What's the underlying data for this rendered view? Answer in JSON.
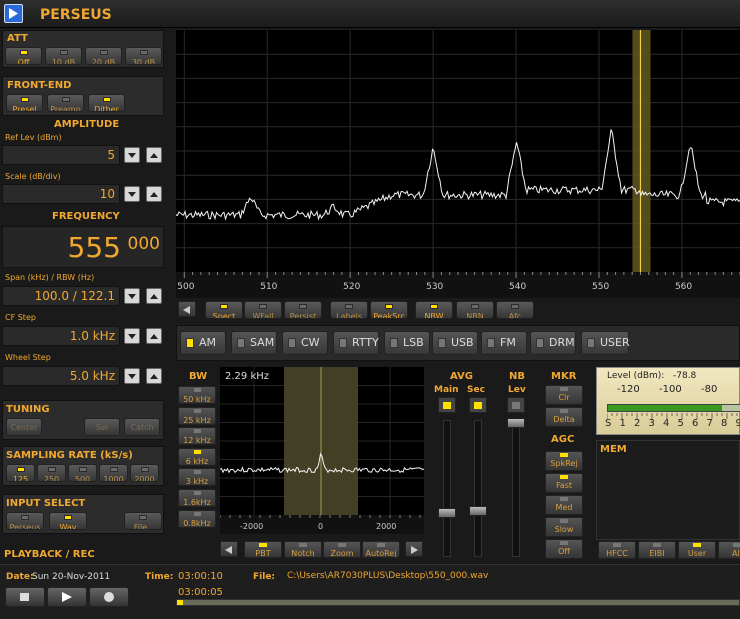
{
  "app": {
    "title": "PERSEUS"
  },
  "att": {
    "title": "ATT",
    "buttons": [
      {
        "label": "Off",
        "on": true
      },
      {
        "label": "10 dB",
        "on": false
      },
      {
        "label": "20 dB",
        "on": false
      },
      {
        "label": "30 dB",
        "on": false
      }
    ]
  },
  "frontend": {
    "title": "FRONT-END",
    "buttons": [
      {
        "label": "Presel",
        "on": true
      },
      {
        "label": "Preamp",
        "on": false
      },
      {
        "label": "Dither",
        "on": true
      }
    ]
  },
  "amplitude": {
    "title": "AMPLITUDE",
    "ref_label": "Ref Lev (dBm)",
    "ref_value": "5",
    "scale_label": "Scale (dB/div)",
    "scale_value": "10"
  },
  "frequency": {
    "title": "FREQUENCY",
    "main": "555",
    "sub": "000",
    "span_label": "Span (kHz) / RBW (Hz)",
    "span_value": "100.0 / 122.1",
    "cf_label": "CF Step",
    "cf_value": "1.0 kHz",
    "wheel_label": "Wheel Step",
    "wheel_value": "5.0 kHz"
  },
  "tuning": {
    "title": "TUNING",
    "buttons": [
      "Center",
      "Sel",
      "Catch"
    ]
  },
  "sampling": {
    "title": "SAMPLING RATE (kS/s)",
    "buttons": [
      {
        "label": "125",
        "on": true
      },
      {
        "label": "250",
        "on": false
      },
      {
        "label": "500",
        "on": false
      },
      {
        "label": "1000",
        "on": false
      },
      {
        "label": "2000",
        "on": false
      }
    ]
  },
  "input": {
    "title": "INPUT SELECT",
    "buttons": [
      {
        "label": "Perseus",
        "on": false
      },
      {
        "label": "Wav",
        "on": true
      },
      {
        "label": "File..",
        "on": false
      }
    ]
  },
  "playback": {
    "title": "PLAYBACK / REC",
    "date_label": "Date:",
    "date": "Sun 20-Nov-2011",
    "time_label": "Time:",
    "time": "03:00:10",
    "file_label": "File:",
    "file": "C:\\Users\\AR7030PLUS\\Desktop\\550_000.wav",
    "elapsed": "03:00:05",
    "progress": 0.01
  },
  "spectrum": {
    "x_ticks": [
      "500",
      "510",
      "520",
      "530",
      "540",
      "550",
      "560"
    ],
    "x_range": [
      499,
      567
    ],
    "marker": 555,
    "buttons": [
      {
        "label": "Spect",
        "on": true
      },
      {
        "label": "WFall",
        "on": false
      },
      {
        "label": "Persist",
        "on": false
      },
      {
        "label": "Labels",
        "on": false
      },
      {
        "label": "PeakSrc",
        "on": true
      },
      {
        "label": "NBW",
        "on": true
      },
      {
        "label": "NBN",
        "on": false
      },
      {
        "label": "Afc",
        "on": false
      }
    ]
  },
  "modes": [
    {
      "label": "AM",
      "on": true
    },
    {
      "label": "SAM",
      "on": false
    },
    {
      "label": "CW",
      "on": false
    },
    {
      "label": "RTTY",
      "on": false
    },
    {
      "label": "LSB",
      "on": false
    },
    {
      "label": "USB",
      "on": false
    },
    {
      "label": "FM",
      "on": false
    },
    {
      "label": "DRM",
      "on": false
    },
    {
      "label": "USER",
      "on": false
    }
  ],
  "bw": {
    "title": "BW",
    "value": "2.29 kHz",
    "buttons": [
      {
        "label": "50 kHz",
        "on": false
      },
      {
        "label": "25 kHz",
        "on": false
      },
      {
        "label": "12 kHz",
        "on": false
      },
      {
        "label": "6 kHz",
        "on": true
      },
      {
        "label": "3 kHz",
        "on": false
      },
      {
        "label": "1.6kHz",
        "on": false
      },
      {
        "label": "0.8kHz",
        "on": false
      }
    ],
    "x_ticks": [
      "-2000",
      "0",
      "2000"
    ],
    "bottom_buttons": [
      {
        "label": "PBT",
        "on": true
      },
      {
        "label": "Notch",
        "on": false
      },
      {
        "label": "Zoom",
        "on": false
      },
      {
        "label": "AutoRej",
        "on": false
      }
    ]
  },
  "avg": {
    "title": "AVG",
    "main": "Main",
    "sec": "Sec"
  },
  "nb": {
    "title": "NB",
    "lev": "Lev"
  },
  "mkr": {
    "title": "MKR",
    "buttons": [
      "Clr",
      "Delta"
    ]
  },
  "agc": {
    "title": "AGC",
    "buttons": [
      {
        "label": "SpkRej",
        "on": true
      },
      {
        "label": "Fast",
        "on": true
      },
      {
        "label": "Med",
        "on": false
      },
      {
        "label": "Slow",
        "on": false
      },
      {
        "label": "Off",
        "on": false
      }
    ]
  },
  "meter": {
    "level_label": "Level (dBm):",
    "level_value": "-78.8",
    "scale_top": [
      "-120",
      "-100",
      "-80"
    ],
    "scale_s": [
      "S",
      "1",
      "2",
      "3",
      "4",
      "5",
      "6",
      "7",
      "8",
      "9"
    ],
    "fill": 0.86
  },
  "mem": {
    "title": "MEM",
    "buttons": [
      {
        "label": "HFCC",
        "on": false
      },
      {
        "label": "EIBI",
        "on": false
      },
      {
        "label": "User",
        "on": true
      },
      {
        "label": "All",
        "on": false
      }
    ]
  },
  "colors": {
    "accent": "#f0a830",
    "led": "#ffe000"
  }
}
